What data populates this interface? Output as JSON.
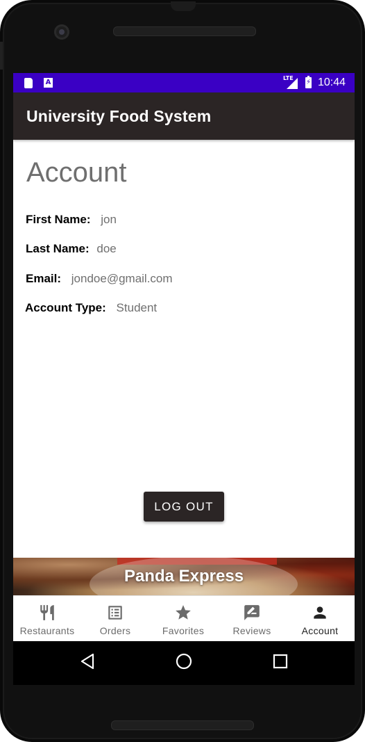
{
  "status_bar": {
    "time": "10:44",
    "network": "LTE",
    "color": "#3a00c4",
    "icons": [
      "sd-card-icon",
      "a-notification-icon",
      "signal-icon",
      "battery-charging-icon"
    ]
  },
  "app_bar": {
    "title": "University Food System",
    "color": "#2b2525"
  },
  "account": {
    "title": "Account",
    "fields": [
      {
        "label": "First Name:",
        "value": "jon"
      },
      {
        "label": "Last Name:",
        "value": "doe"
      },
      {
        "label": "Email:",
        "value": "jondoe@gmail.com"
      },
      {
        "label": "Account Type:",
        "value": "Student"
      }
    ],
    "logout_label": "LOG OUT"
  },
  "banner": {
    "name": "Panda Express"
  },
  "bottom_nav": {
    "items": [
      {
        "label": "Restaurants",
        "icon": "restaurant-icon"
      },
      {
        "label": "Orders",
        "icon": "list-icon"
      },
      {
        "label": "Favorites",
        "icon": "star-icon"
      },
      {
        "label": "Reviews",
        "icon": "rate-review-icon"
      },
      {
        "label": "Account",
        "icon": "person-icon"
      }
    ],
    "active": "Account"
  },
  "system_nav": {
    "icons": [
      "back-icon",
      "home-icon",
      "recents-icon"
    ]
  }
}
